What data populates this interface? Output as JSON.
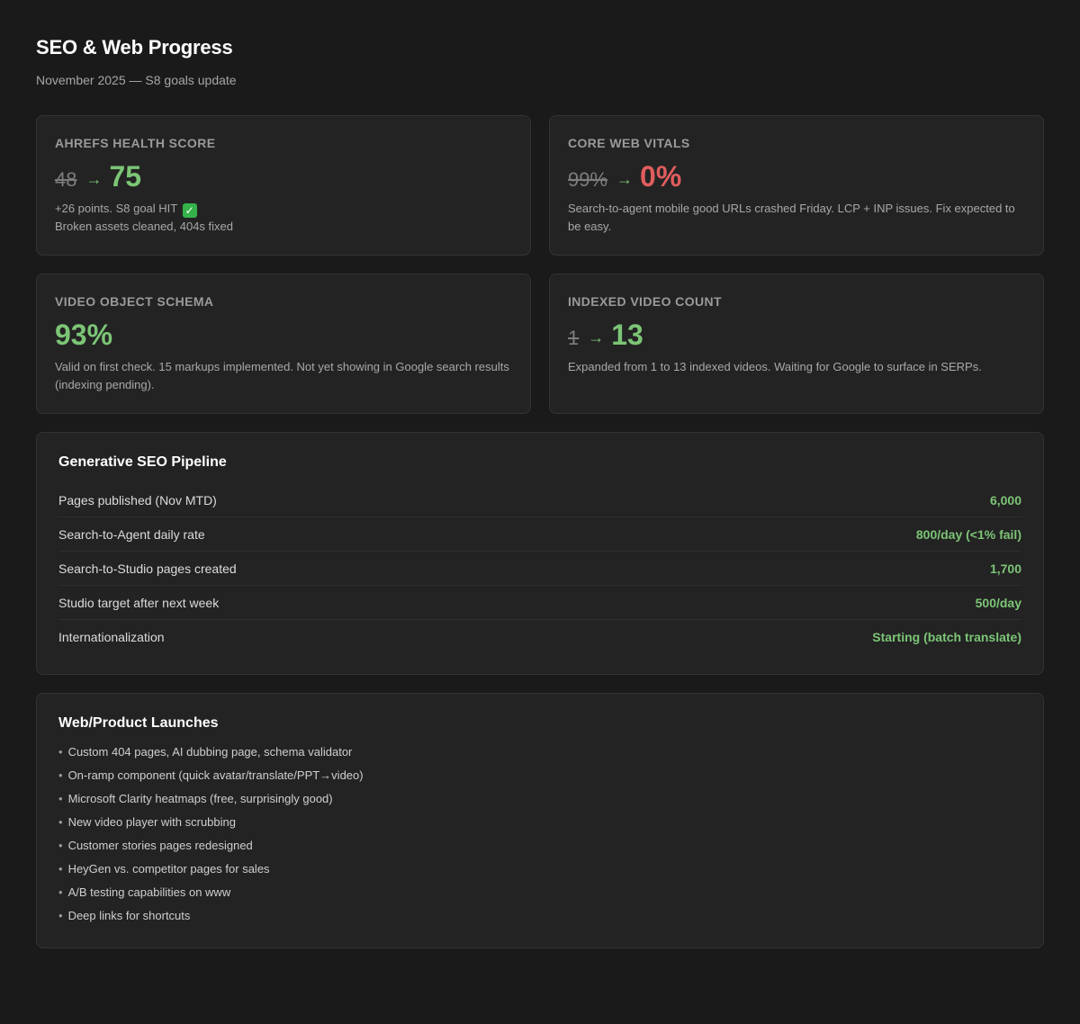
{
  "header": {
    "title": "SEO & Web Progress",
    "subtitle": "November 2025 — S8 goals update"
  },
  "cards": [
    {
      "label": "Ahrefs Health Score",
      "old_value": "48",
      "new_value": "75",
      "new_color": "#7cc576",
      "note_lines": [
        "+26 points. S8 goal HIT",
        "Broken assets cleaned, 404s fixed"
      ]
    },
    {
      "label": "Core Web Vitals",
      "old_value": "99%",
      "new_value": "0%",
      "new_color": "#e05d5d",
      "note_lines": [
        "Search-to-agent mobile good URLs crashed Friday. LCP + INP issues. Fix expected to be easy."
      ]
    },
    {
      "label": "Video Object Schema",
      "new_value": "93%",
      "new_color": "#7cc576",
      "note_lines": [
        "Valid on first check. 15 markups implemented. Not yet showing in Google search results (indexing pending)."
      ]
    },
    {
      "label": "Indexed Video Count",
      "old_value": "1",
      "new_value": "13",
      "new_color": "#7cc576",
      "note_lines": [
        "Expanded from 1 to 13 indexed videos. Waiting for Google to surface in SERPs."
      ]
    }
  ],
  "arrow": "→",
  "pipeline": {
    "title": "Generative SEO Pipeline",
    "rows": [
      {
        "label": "Pages published (Nov MTD)",
        "value": "6,000"
      },
      {
        "label": "Search-to-Agent daily rate",
        "value": "800/day (<1% fail)"
      },
      {
        "label": "Search-to-Studio pages created",
        "value": "1,700"
      },
      {
        "label": "Studio target after next week",
        "value": "500/day"
      },
      {
        "label": "Internationalization",
        "value": "Starting (batch translate)"
      }
    ]
  },
  "launches": {
    "title": "Web/Product Launches",
    "items": [
      "Custom 404 pages, AI dubbing page, schema validator",
      "On-ramp component (quick avatar/translate/PPT→video)",
      "Microsoft Clarity heatmaps (free, surprisingly good)",
      "New video player with scrubbing",
      "Customer stories pages redesigned",
      "HeyGen vs. competitor pages for sales",
      "A/B testing capabilities on www",
      "Deep links for shortcuts"
    ]
  },
  "icons": {
    "goal_check": "check-mark-icon"
  }
}
